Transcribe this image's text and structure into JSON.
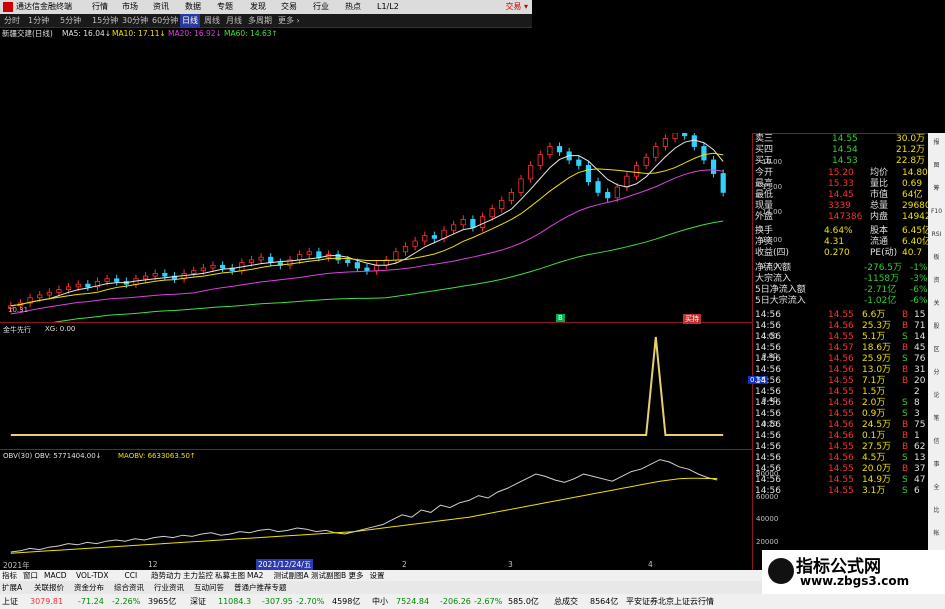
{
  "titlebar": {
    "app": "通达信金融终端",
    "menus": [
      "行情",
      "市场",
      "资讯",
      "数据",
      "专题",
      "发现",
      "交易",
      "行业",
      "热点",
      "L1/L2"
    ],
    "trade": "交易 ▾"
  },
  "periods": [
    "分时",
    "1分钟",
    "5分钟",
    "15分钟",
    "30分钟",
    "60分钟",
    "日线",
    "周线",
    "月线",
    "多周期",
    "更多 ›"
  ],
  "active_period": "日线",
  "stock": {
    "name": "新疆交建(日线)",
    "ma5": "MA5: 16.04↓",
    "ma10": "MA10: 17.11↓",
    "ma20": "MA20: 16.92↓",
    "ma60": "MA60: 14.63↑",
    "low_label": "10.31"
  },
  "price_axis": [
    "16.00",
    "15.00",
    "14.00",
    "13.00",
    "12.00"
  ],
  "indicator1": {
    "name": "金牛先行",
    "value": "XG: 0.00",
    "axis": [
      "1.00",
      "0.80",
      "0.55",
      "0.40",
      "0.20"
    ],
    "badges": [
      "B",
      "买持"
    ]
  },
  "indicator2": {
    "obv": "OBV(30)  OBV: 5771404.00↓",
    "maobv": "MAOBV: 6633063.50↑",
    "axis": [
      "80000",
      "60000",
      "40000",
      "20000"
    ]
  },
  "x_labels": [
    "2021年",
    "12",
    "2021/12/24/五",
    "2",
    "3",
    "4"
  ],
  "quote": {
    "book": [
      {
        "label": "卖三",
        "price": "14.55",
        "vol": "30.0万"
      },
      {
        "label": "买四",
        "price": "14.54",
        "vol": "21.2万"
      },
      {
        "label": "买五",
        "price": "14.53",
        "vol": "22.8万"
      }
    ],
    "stats": [
      {
        "l1": "今开",
        "v1": "15.20",
        "l2": "均价",
        "v2": "14.80"
      },
      {
        "l1": "最高",
        "v1": "15.33",
        "l2": "量比",
        "v2": "0.69"
      },
      {
        "l1": "最低",
        "v1": "14.45",
        "l2": "市值",
        "v2": "64亿"
      },
      {
        "l1": "现量",
        "v1": "3339",
        "l2": "总量",
        "v2": "296806"
      },
      {
        "l1": "外盘",
        "v1": "147386",
        "l2": "内盘",
        "v2": "149420"
      }
    ],
    "stats2": [
      {
        "l1": "换手",
        "v1": "4.64%",
        "l2": "股本",
        "v2": "6.45亿"
      },
      {
        "l1": "净资",
        "v1": "4.31",
        "l2": "流通",
        "v2": "6.40亿"
      },
      {
        "l1": "收益(四)",
        "v1": "0.270",
        "l2": "PE(动)",
        "v2": "40.7"
      }
    ],
    "flows": [
      {
        "label": "净流入额",
        "value": "-276.5万",
        "pct": "-1%"
      },
      {
        "label": "大宗流入",
        "value": "-1158万",
        "pct": "-3%"
      },
      {
        "label": "5日净流入额",
        "value": "-2.71亿",
        "pct": "-6%"
      },
      {
        "label": "5日大宗流入",
        "value": "-1.02亿",
        "pct": "-6%"
      }
    ],
    "ticks": [
      {
        "t": "14:56",
        "p": "14.55",
        "v": "6.6万",
        "s": "B",
        "n": "15"
      },
      {
        "t": "14:56",
        "p": "14.56",
        "v": "25.3万",
        "s": "B",
        "n": "71"
      },
      {
        "t": "14:56",
        "p": "14.55",
        "v": "5.1万",
        "s": "S",
        "n": "14"
      },
      {
        "t": "14:56",
        "p": "14.57",
        "v": "18.6万",
        "s": "B",
        "n": "45"
      },
      {
        "t": "14:56",
        "p": "14.56",
        "v": "25.9万",
        "s": "S",
        "n": "76"
      },
      {
        "t": "14:56",
        "p": "14.56",
        "v": "13.0万",
        "s": "B",
        "n": "31"
      },
      {
        "t": "14:56",
        "p": "14.55",
        "v": "7.1万",
        "s": "B",
        "n": "20"
      },
      {
        "t": "14:56",
        "p": "14.55",
        "v": "1.5万",
        "s": "",
        "n": "2"
      },
      {
        "t": "14:56",
        "p": "14.56",
        "v": "2.0万",
        "s": "S",
        "n": "8"
      },
      {
        "t": "14:56",
        "p": "14.55",
        "v": "0.9万",
        "s": "S",
        "n": "3"
      },
      {
        "t": "14:56",
        "p": "14.56",
        "v": "24.5万",
        "s": "B",
        "n": "75"
      },
      {
        "t": "14:56",
        "p": "14.56",
        "v": "0.1万",
        "s": "B",
        "n": "1"
      },
      {
        "t": "14:56",
        "p": "14.55",
        "v": "27.5万",
        "s": "B",
        "n": "62"
      },
      {
        "t": "14:56",
        "p": "14.56",
        "v": "4.5万",
        "s": "S",
        "n": "13"
      },
      {
        "t": "14:56",
        "p": "14.55",
        "v": "20.0万",
        "s": "B",
        "n": "37"
      },
      {
        "t": "14:56",
        "p": "14.55",
        "v": "14.9万",
        "s": "S",
        "n": "47"
      },
      {
        "t": "14:56",
        "p": "14.55",
        "v": "3.1万",
        "s": "S",
        "n": "6"
      }
    ]
  },
  "sidebar_icons": [
    "报",
    "图",
    "筹",
    "F10",
    "RSI",
    "板",
    "资",
    "关",
    "股",
    "区",
    "分",
    "论",
    "笔",
    "信",
    "事",
    "全",
    "比",
    "帐",
    "窗"
  ],
  "indicators_tabs": [
    "指标",
    "窗口",
    "MACD",
    "VOL-TDX",
    "CCI",
    "趋势动力",
    "主力监控",
    "私募主图",
    "MA2",
    "测试副图A",
    "测试副图B",
    "更多",
    "设置"
  ],
  "trade_tabs": [
    "扩展A",
    "关联报价",
    "资金分布",
    "综合资讯",
    "行业资讯",
    "互动问答",
    "普通户推荐专题"
  ],
  "status": {
    "sh": {
      "name": "上证",
      "value": "3079.81",
      "chg": "-71.24",
      "pct": "-2.26%",
      "amt": "3965亿"
    },
    "sz": {
      "name": "深证",
      "value": "11084.3",
      "chg": "-307.95",
      "pct": "-2.70%",
      "amt": "4598亿"
    },
    "zx": {
      "name": "中小",
      "value": "7524.84",
      "chg": "-206.26",
      "pct": "-2.67%",
      "amt": "585.0亿"
    },
    "total": {
      "name": "总成交",
      "amt": "8564亿"
    },
    "broker": "平安证券北京上证云行情"
  },
  "watermark": {
    "line1": "指标公式网",
    "line2": "www.zbgs3.com"
  },
  "chart_data": [
    {
      "type": "candlestick",
      "title": "新疆交建(日线)",
      "ylim": [
        10,
        17
      ],
      "series": [
        {
          "name": "MA5",
          "value": 16.04
        },
        {
          "name": "MA10",
          "value": 17.11
        },
        {
          "name": "MA20",
          "value": 16.92
        },
        {
          "name": "MA60",
          "value": 14.63
        }
      ],
      "closes": [
        10.6,
        10.7,
        10.9,
        11.0,
        11.1,
        11.2,
        11.3,
        11.4,
        11.3,
        11.5,
        11.6,
        11.5,
        11.4,
        11.6,
        11.7,
        11.8,
        11.7,
        11.6,
        11.8,
        11.9,
        12.0,
        12.1,
        12.0,
        11.9,
        12.2,
        12.3,
        12.4,
        12.2,
        12.1,
        12.3,
        12.5,
        12.6,
        12.4,
        12.5,
        12.3,
        12.2,
        12.0,
        11.9,
        12.1,
        12.3,
        12.6,
        12.8,
        13.0,
        13.2,
        13.1,
        13.4,
        13.6,
        13.8,
        13.5,
        13.9,
        14.2,
        14.5,
        14.8,
        15.3,
        15.8,
        16.2,
        16.5,
        16.3,
        16.0,
        15.8,
        15.2,
        14.8,
        14.6,
        15.0,
        15.4,
        15.8,
        16.1,
        16.5,
        16.8,
        17.0,
        16.9,
        16.5,
        16.0,
        15.5,
        14.8
      ]
    },
    {
      "type": "line",
      "title": "金牛先行",
      "ylim": [
        0,
        1
      ],
      "series": [
        {
          "name": "XG",
          "values_note_spike": [
            0,
            0,
            0,
            0,
            0,
            0,
            0,
            0,
            0,
            0,
            0,
            0,
            0,
            0,
            0,
            0,
            0,
            0,
            0,
            0,
            0,
            0,
            0,
            0,
            0,
            0,
            0,
            0,
            0,
            0,
            0,
            0,
            0,
            0,
            0,
            0,
            0,
            0,
            0,
            0,
            0,
            0,
            0,
            0,
            0,
            0,
            0,
            0,
            0,
            0,
            0,
            0,
            0,
            0,
            0,
            0,
            0,
            0,
            0,
            0,
            0,
            0,
            0,
            0,
            0,
            0,
            0,
            1,
            0,
            0,
            0,
            0,
            0,
            0,
            0
          ]
        }
      ]
    },
    {
      "type": "line",
      "title": "OBV(30)",
      "ylim": [
        0,
        90000
      ],
      "series": [
        {
          "name": "OBV",
          "values": [
            5000,
            6000,
            8000,
            7000,
            9000,
            10000,
            12000,
            11000,
            13000,
            12000,
            14000,
            15000,
            14000,
            16000,
            15000,
            17000,
            18000,
            17000,
            19000,
            18000,
            20000,
            21000,
            19000,
            20000,
            22000,
            21000,
            23000,
            24000,
            22000,
            23000,
            25000,
            24000,
            22000,
            23000,
            21000,
            20000,
            22000,
            24000,
            26000,
            28000,
            32000,
            36000,
            34000,
            40000,
            38000,
            44000,
            42000,
            46000,
            48000,
            52000,
            50000,
            55000,
            58000,
            62000,
            66000,
            70000,
            68000,
            65000,
            63000,
            66000,
            70000,
            68000,
            66000,
            64000,
            68000,
            72000,
            74000,
            78000,
            82000,
            80000,
            76000,
            74000,
            70000,
            67000,
            65000
          ]
        },
        {
          "name": "MAOBV",
          "values": [
            4000,
            4500,
            5000,
            5500,
            6000,
            6500,
            7000,
            7500,
            8000,
            8500,
            9000,
            9500,
            10000,
            10500,
            11000,
            11500,
            12000,
            12500,
            13000,
            13500,
            14000,
            14500,
            15000,
            15500,
            16000,
            16500,
            17000,
            17500,
            18000,
            18500,
            19000,
            19500,
            20000,
            20500,
            21000,
            21500,
            22000,
            23000,
            24000,
            25000,
            26000,
            27000,
            28000,
            29000,
            30000,
            31000,
            32000,
            33000,
            34000,
            35500,
            37000,
            38500,
            40000,
            41500,
            43000,
            44500,
            46000,
            47500,
            49000,
            50500,
            52000,
            53500,
            55000,
            56500,
            58000,
            59500,
            61000,
            62500,
            64000,
            65000,
            66000,
            66500,
            66500,
            66300,
            66300
          ]
        }
      ]
    }
  ]
}
